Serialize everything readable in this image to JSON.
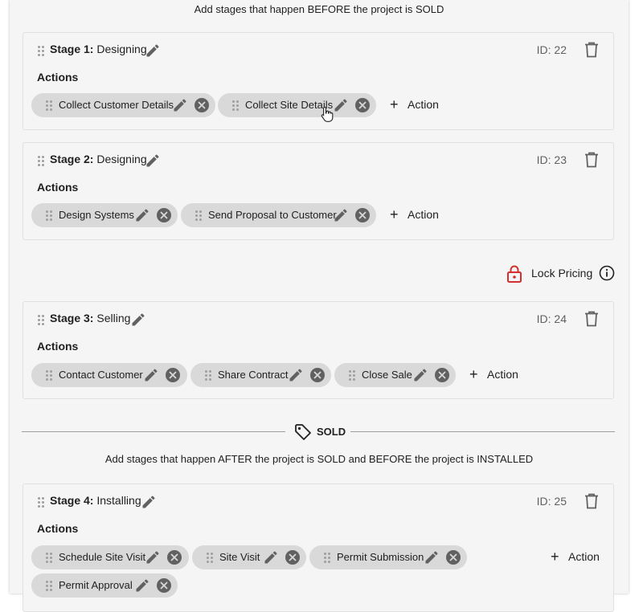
{
  "before_sold_hint": "Add stages that happen BEFORE the project is SOLD",
  "after_sold_hint": "Add stages that happen AFTER the project is SOLD and BEFORE the project is INSTALLED",
  "sold_divider_label": "SOLD",
  "lock_pricing": {
    "label": "Lock Pricing",
    "lock_color": "#d32f2f"
  },
  "add_action_label": "Action",
  "actions_heading": "Actions",
  "stages": [
    {
      "prefix": "Stage 1:",
      "name": "Designing",
      "id": "ID: 22",
      "actions": [
        "Collect Customer Details",
        "Collect Site Details"
      ]
    },
    {
      "prefix": "Stage 2:",
      "name": "Designing",
      "id": "ID: 23",
      "actions": [
        "Design Systems",
        "Send Proposal to Customer"
      ]
    },
    {
      "prefix": "Stage 3:",
      "name": "Selling",
      "id": "ID: 24",
      "actions": [
        "Contact Customer",
        "Share Contract",
        "Close Sale"
      ]
    },
    {
      "prefix": "Stage 4:",
      "name": "Installing",
      "id": "ID: 25",
      "actions": [
        "Schedule Site Visit",
        "Site Visit",
        "Permit Submission",
        "Permit Approval"
      ]
    }
  ],
  "icons": [
    "drag-handle-icon",
    "pencil-icon",
    "trash-icon",
    "close-circle-icon",
    "plus-icon",
    "lock-icon",
    "info-icon",
    "tag-icon",
    "hand-pointer-cursor"
  ]
}
